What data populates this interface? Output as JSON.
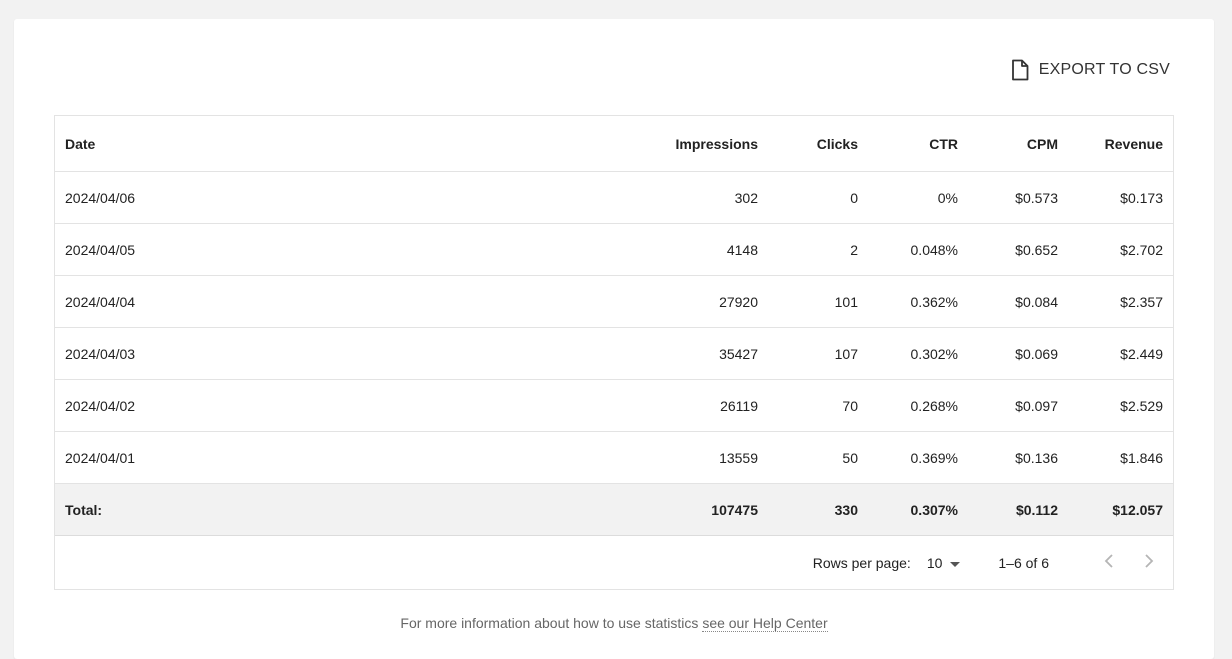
{
  "toolbar": {
    "export_label": "EXPORT TO CSV",
    "export_icon": "file-icon"
  },
  "table": {
    "headers": [
      "Date",
      "Impressions",
      "Clicks",
      "CTR",
      "CPM",
      "Revenue"
    ],
    "rows": [
      [
        "2024/04/06",
        "302",
        "0",
        "0%",
        "$0.573",
        "$0.173"
      ],
      [
        "2024/04/05",
        "4148",
        "2",
        "0.048%",
        "$0.652",
        "$2.702"
      ],
      [
        "2024/04/04",
        "27920",
        "101",
        "0.362%",
        "$0.084",
        "$2.357"
      ],
      [
        "2024/04/03",
        "35427",
        "107",
        "0.302%",
        "$0.069",
        "$2.449"
      ],
      [
        "2024/04/02",
        "26119",
        "70",
        "0.268%",
        "$0.097",
        "$2.529"
      ],
      [
        "2024/04/01",
        "13559",
        "50",
        "0.369%",
        "$0.136",
        "$1.846"
      ]
    ],
    "total": [
      "Total:",
      "107475",
      "330",
      "0.307%",
      "$0.112",
      "$12.057"
    ]
  },
  "pagination": {
    "rows_per_page_label": "Rows per page:",
    "rows_per_page_value": "10",
    "range_label": "1–6 of 6",
    "prev_icon": "chevron-left-icon",
    "next_icon": "chevron-right-icon"
  },
  "footer": {
    "text": "For more information about how to use statistics",
    "link_text": "see our Help Center"
  }
}
